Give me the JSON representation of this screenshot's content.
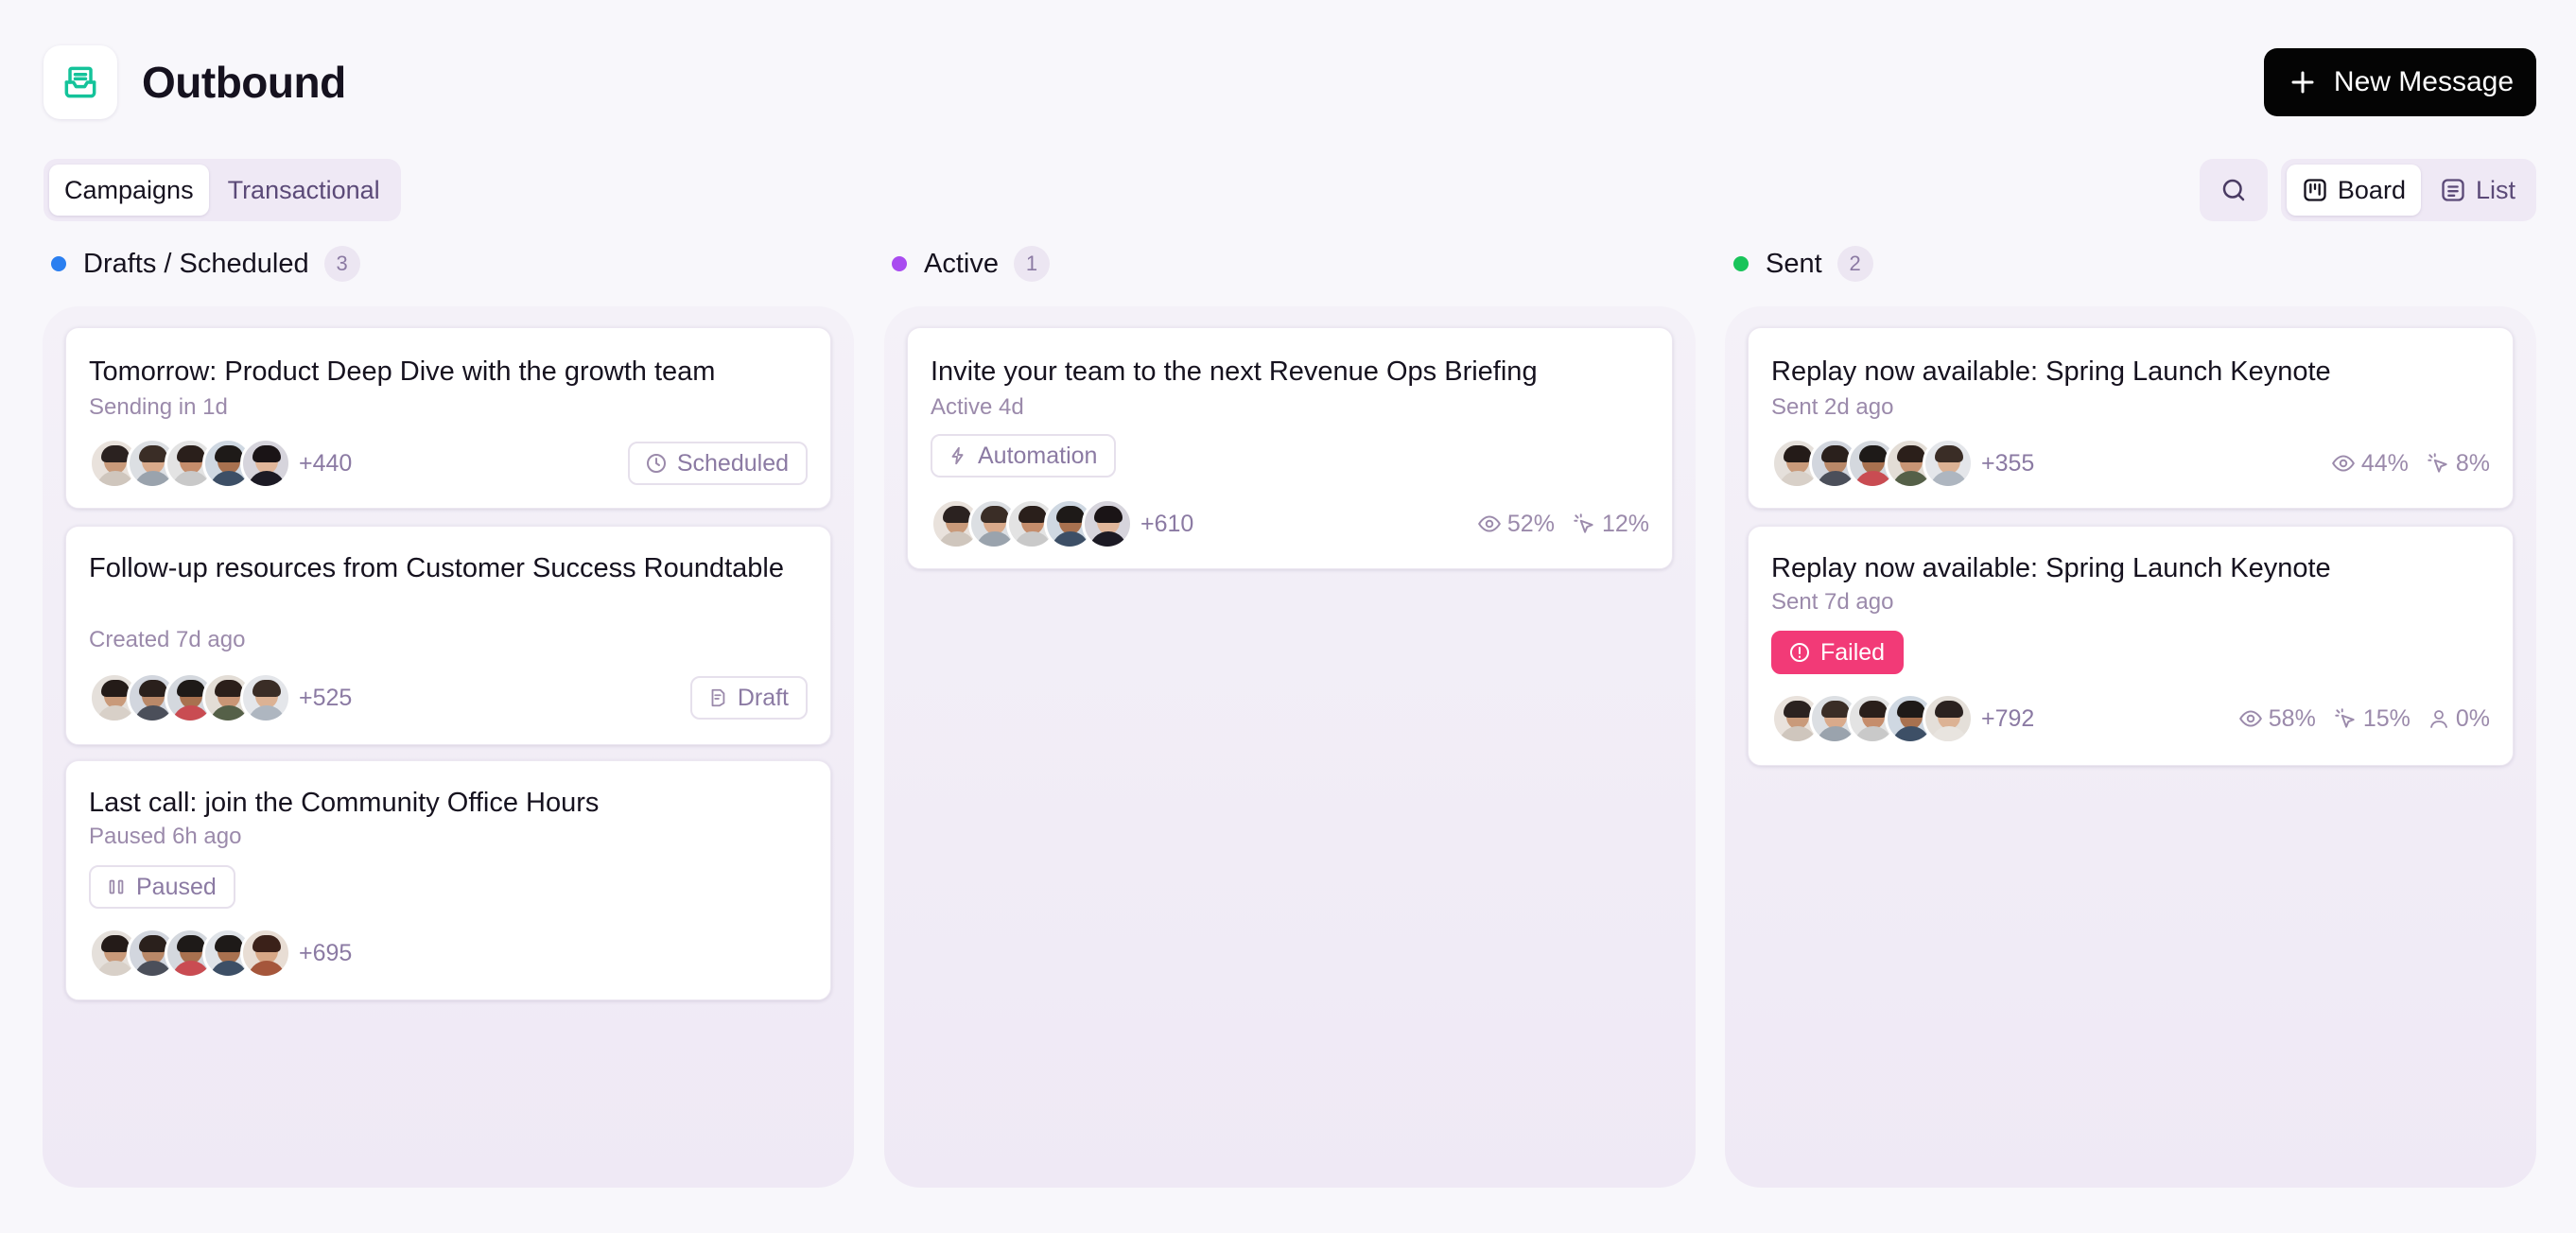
{
  "app": {
    "title": "Outbound",
    "logo_icon": "inbox-icon"
  },
  "header": {
    "new_message_label": "New Message"
  },
  "tabs": [
    {
      "label": "Campaigns",
      "active": true
    },
    {
      "label": "Transactional",
      "active": false
    }
  ],
  "view_toggle": [
    {
      "label": "Board",
      "icon": "kanban-icon",
      "active": true
    },
    {
      "label": "List",
      "icon": "list-icon",
      "active": false
    }
  ],
  "columns": [
    {
      "title": "Drafts / Scheduled",
      "count": "3",
      "color": "#2b7ff0",
      "cards": [
        {
          "title": "Tomorrow: Product Deep Dive with the growth team",
          "subtitle": "Sending in 1d",
          "audience": "+440",
          "status": "Scheduled",
          "status_icon": "clock-icon"
        },
        {
          "title": "Follow-up resources from Customer Success Roundtable",
          "subtitle": "Created 7d ago",
          "audience": "+525",
          "status": "Draft",
          "status_icon": "document-icon"
        },
        {
          "title": "Last call: join the Community Office Hours",
          "subtitle": "Paused 6h ago",
          "audience": "+695",
          "status": "Paused",
          "status_icon": "pause-icon"
        }
      ]
    },
    {
      "title": "Active",
      "count": "1",
      "color": "#a94cf0",
      "cards": [
        {
          "title": "Invite your team to the next Revenue Ops Briefing",
          "subtitle": "Active 4d",
          "audience": "+610",
          "status": "Automation",
          "status_icon": "bolt-icon",
          "opens": "52%",
          "clicks": "12%"
        }
      ]
    },
    {
      "title": "Sent",
      "count": "2",
      "color": "#19c45a",
      "cards": [
        {
          "title": "Replay now available: Spring Launch Keynote",
          "subtitle": "Sent 2d ago",
          "audience": "+355",
          "opens": "44%",
          "clicks": "8%"
        },
        {
          "title": "Replay now available: Spring Launch Keynote",
          "subtitle": "Sent 7d ago",
          "audience": "+792",
          "status": "Failed",
          "status_icon": "alert-icon",
          "opens": "58%",
          "clicks": "15%",
          "unsubscribes": "0%"
        }
      ]
    }
  ]
}
